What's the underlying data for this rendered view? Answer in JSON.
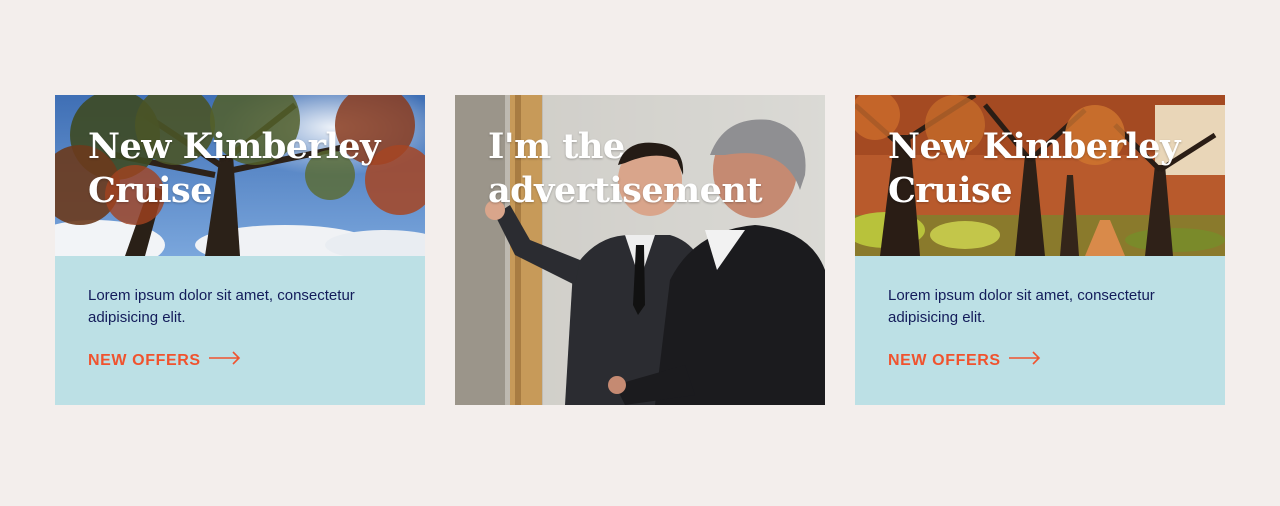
{
  "cards": [
    {
      "title_line1": "New Kimberley",
      "title_line2": "Cruise",
      "description": "Lorem ipsum dolor sit amet, consectetur adipisicing elit.",
      "link_label": "NEW OFFERS",
      "image": "autumn-tree-blue-sky-photo"
    },
    {
      "title_line1": "I'm the",
      "title_line2": "advertisement",
      "image": "men-at-whiteboard-photo"
    },
    {
      "title_line1": "New Kimberley",
      "title_line2": "Cruise",
      "description": "Lorem ipsum dolor sit amet, consectetur adipisicing elit.",
      "link_label": "NEW OFFERS",
      "image": "autumn-tree-avenue-photo"
    }
  ],
  "colors": {
    "page_background": "#f3eeec",
    "card_body": "#bce0e5",
    "text": "#131c5a",
    "accent": "#f0532e"
  }
}
